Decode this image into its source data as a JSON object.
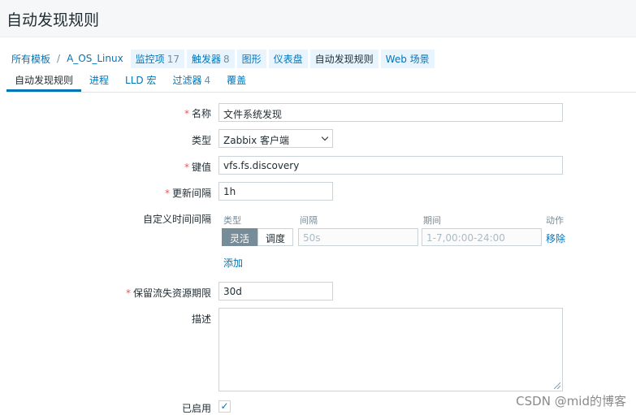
{
  "page": {
    "title": "自动发现规则"
  },
  "breadcrumb": {
    "items": [
      {
        "label": "所有模板"
      },
      {
        "label": "A_OS_Linux"
      }
    ],
    "tabs": [
      {
        "label": "监控项",
        "count": "17"
      },
      {
        "label": "触发器",
        "count": "8"
      },
      {
        "label": "图形",
        "count": ""
      },
      {
        "label": "仪表盘",
        "count": ""
      },
      {
        "label": "自动发现规则",
        "count": ""
      },
      {
        "label": "Web 场景",
        "count": ""
      }
    ]
  },
  "form_tabs": [
    {
      "label": "自动发现规则",
      "count": ""
    },
    {
      "label": "进程",
      "count": ""
    },
    {
      "label": "LLD 宏",
      "count": ""
    },
    {
      "label": "过滤器",
      "count": "4"
    },
    {
      "label": "覆盖",
      "count": ""
    }
  ],
  "form": {
    "name": {
      "label": "名称",
      "value": "文件系统发现"
    },
    "type": {
      "label": "类型",
      "value": "Zabbix 客户端"
    },
    "key": {
      "label": "键值",
      "value": "vfs.fs.discovery"
    },
    "update_interval": {
      "label": "更新间隔",
      "value": "1h"
    },
    "custom_intervals": {
      "label": "自定义时间间隔",
      "headers": {
        "type": "类型",
        "interval": "间隔",
        "period": "期间",
        "action": "动作"
      },
      "row": {
        "type_options": [
          "灵活",
          "调度"
        ],
        "interval_placeholder": "50s",
        "period_placeholder": "1-7,00:00-24:00",
        "remove": "移除"
      },
      "add": "添加"
    },
    "keep_lost": {
      "label": "保留流失资源期限",
      "value": "30d"
    },
    "description": {
      "label": "描述",
      "value": ""
    },
    "enabled": {
      "label": "已启用",
      "checked": true,
      "mark": "✓"
    }
  },
  "watermark": "CSDN @mid的博客"
}
